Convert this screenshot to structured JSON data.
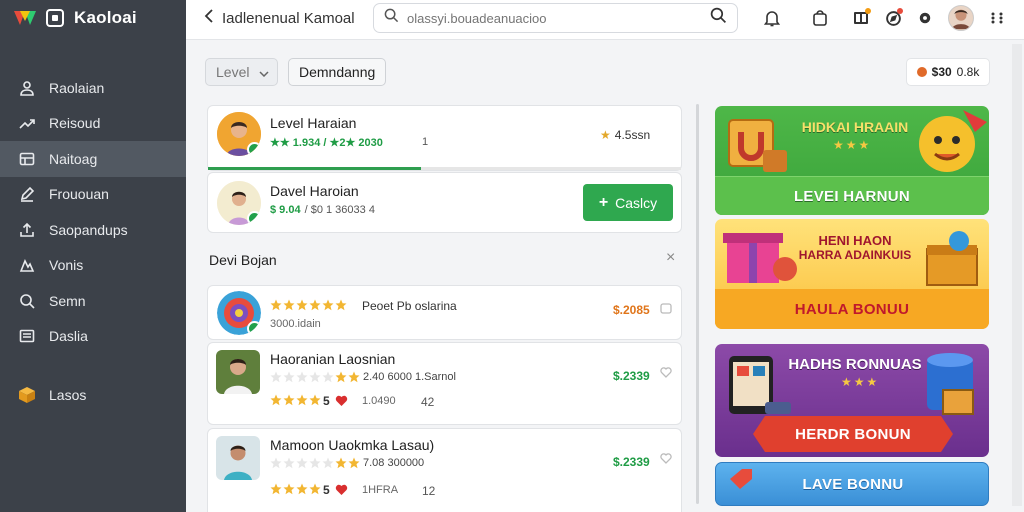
{
  "app": {
    "title": "Kaoloai"
  },
  "sidebar": {
    "items": [
      {
        "label": "Raolaian",
        "icon": "user-icon",
        "active": false
      },
      {
        "label": "Reisoud",
        "icon": "trend-icon",
        "active": false
      },
      {
        "label": "Naitoag",
        "icon": "grid-icon",
        "active": true
      },
      {
        "label": "Frououan",
        "icon": "pen-icon",
        "active": false
      },
      {
        "label": "Saopandups",
        "icon": "upload-icon",
        "active": false
      },
      {
        "label": "Vonis",
        "icon": "chart-icon",
        "active": false
      },
      {
        "label": "Semn",
        "icon": "search-icon",
        "active": false
      },
      {
        "label": "Daslia",
        "icon": "list-icon",
        "active": false
      }
    ],
    "extra": {
      "label": "Lasos",
      "icon": "box-icon"
    }
  },
  "topbar": {
    "back_label": "Iadlenenual Kamoal",
    "search_placeholder": "olassyi.bouadeanuacioo"
  },
  "filters": {
    "level_select": "Level",
    "chip_label": "Demndanng"
  },
  "balance": {
    "value": "$30",
    "label": "0.8k"
  },
  "cards": [
    {
      "title": "Level Haraian",
      "sub": "★★ 1.934 / ★2★ 2030",
      "extra": "1",
      "right_text": "4.5ssn",
      "progress": 0.45
    },
    {
      "title": "Davel Haroian",
      "sub_green": "$ 9.04",
      "sub": "/ $0 1 36033 4",
      "button_label": "Caslcy"
    }
  ],
  "section": {
    "title": "Devi Bojan",
    "close": "×"
  },
  "items": [
    {
      "line1": "Peoet Pb oslarina",
      "line2": "3000.idain",
      "price": "$.2085",
      "price_color": "#e0751a"
    },
    {
      "title": "Haoranian Laosnian",
      "line1": "2.40 6000 1.Sarnol",
      "line2_num": "5",
      "line2_a": "1.0490",
      "line2_b": "42",
      "price": "$.2339",
      "price_color": "#1f9c45"
    },
    {
      "title": "Mamoon Uaokmka Lasau)",
      "line1": "7.08 300000",
      "line2_num": "5",
      "line2_a": "1HFRA",
      "line2_b": "12",
      "price": "$.2339",
      "price_color": "#1f9c45"
    }
  ],
  "banners": [
    {
      "head": "HIDKAI HRAAIN",
      "button": "LEVEI HARNUN"
    },
    {
      "head1": "HENI HAON",
      "head2": "HARRA ADAINKUIS",
      "button": "HAULA BONUU"
    },
    {
      "head": "HADHS RONNUAS",
      "button": "HERDR BONUN"
    },
    {
      "button": "LAVE BONNU"
    }
  ],
  "colors": {
    "sidebar_bg": "#3c4149",
    "accent_green": "#2fa84f",
    "price_orange": "#e0751a",
    "price_green": "#1f9c45"
  }
}
